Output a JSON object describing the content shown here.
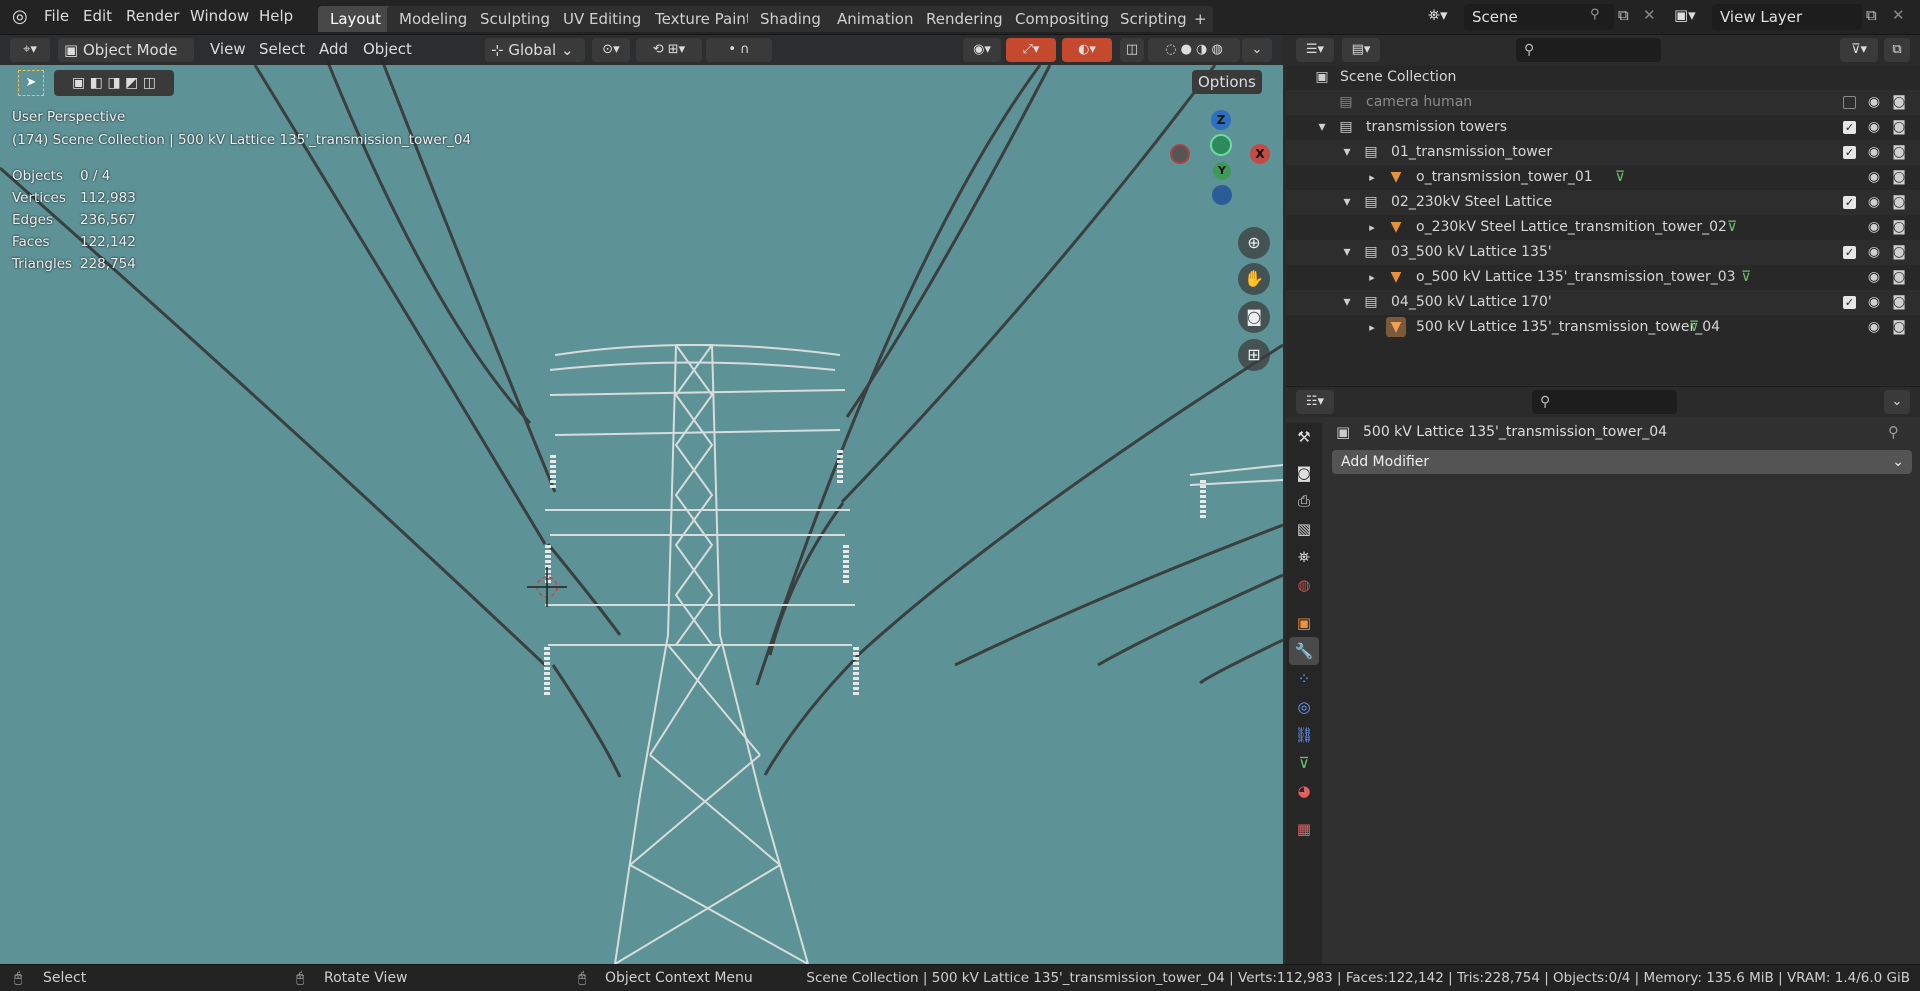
{
  "topbar": {
    "menus": [
      "File",
      "Edit",
      "Render",
      "Window",
      "Help"
    ],
    "workspaces": [
      "Layout",
      "Modeling",
      "Sculpting",
      "UV Editing",
      "Texture Paint",
      "Shading",
      "Animation",
      "Rendering",
      "Compositing",
      "Scripting"
    ],
    "active_workspace": "Layout",
    "add_workspace": "+",
    "scene_name": "Scene",
    "view_layer_name": "View Layer"
  },
  "viewport": {
    "mode": "Object Mode",
    "menus": [
      "View",
      "Select",
      "Add",
      "Object"
    ],
    "orientation": "Global",
    "options_label": "Options",
    "perspective_label": "User Perspective",
    "context_label": "(174) Scene Collection | 500 kV Lattice 135'_transmission_tower_04",
    "stats": [
      {
        "label": "Objects",
        "value": "0 / 4"
      },
      {
        "label": "Vertices",
        "value": "112,983"
      },
      {
        "label": "Edges",
        "value": "236,567"
      },
      {
        "label": "Faces",
        "value": "122,142"
      },
      {
        "label": "Triangles",
        "value": "228,754"
      }
    ],
    "gizmo": {
      "z": "Z",
      "y": "Y",
      "x": "X"
    },
    "background_color": "#5d9296"
  },
  "outliner": {
    "root": "Scene Collection",
    "rows": [
      {
        "name": "camera human",
        "depth": 1,
        "type": "collection",
        "expand": "",
        "disabled": true,
        "checked": false,
        "has_checkbox": true
      },
      {
        "name": "transmission towers",
        "depth": 1,
        "type": "collection",
        "expand": "▾",
        "disabled": false,
        "checked": true,
        "has_checkbox": true
      },
      {
        "name": "01_transmission_tower",
        "depth": 2,
        "type": "collection",
        "expand": "▾",
        "disabled": false,
        "checked": true,
        "has_checkbox": true
      },
      {
        "name": "o_transmission_tower_01",
        "depth": 3,
        "type": "object",
        "expand": "▸",
        "disabled": false,
        "checked": false,
        "has_checkbox": false
      },
      {
        "name": "02_230kV Steel Lattice",
        "depth": 2,
        "type": "collection",
        "expand": "▾",
        "disabled": false,
        "checked": true,
        "has_checkbox": true
      },
      {
        "name": "o_230kV Steel Lattice_transmition_tower_02",
        "depth": 3,
        "type": "object",
        "expand": "▸",
        "disabled": false,
        "checked": false,
        "has_checkbox": false
      },
      {
        "name": "03_500 kV Lattice 135'",
        "depth": 2,
        "type": "collection",
        "expand": "▾",
        "disabled": false,
        "checked": true,
        "has_checkbox": true
      },
      {
        "name": "o_500 kV Lattice 135'_transmission_tower_03",
        "depth": 3,
        "type": "object",
        "expand": "▸",
        "disabled": false,
        "checked": false,
        "has_checkbox": false
      },
      {
        "name": "04_500 kV Lattice 170'",
        "depth": 2,
        "type": "collection",
        "expand": "▾",
        "disabled": false,
        "checked": true,
        "has_checkbox": true
      },
      {
        "name": "500 kV Lattice 135'_transmission_tower_04",
        "depth": 3,
        "type": "object",
        "expand": "▸",
        "disabled": false,
        "checked": false,
        "has_checkbox": false,
        "active": true
      }
    ]
  },
  "properties": {
    "object_name": "500 kV Lattice 135'_transmission_tower_04",
    "add_modifier_label": "Add Modifier",
    "tabs": [
      "tool",
      "render",
      "output",
      "view-layer",
      "scene",
      "world",
      "object",
      "modifiers",
      "particles",
      "physics",
      "constraints",
      "data",
      "material",
      "texture"
    ],
    "active_tab": "modifiers"
  },
  "statusbar": {
    "select_label": "Select",
    "rotate_label": "Rotate View",
    "context_menu_label": "Object Context Menu",
    "info": "Scene Collection | 500 kV Lattice 135'_transmission_tower_04 | Verts:112,983 | Faces:122,142 | Tris:228,754 | Objects:0/4 | Memory: 135.6 MiB | VRAM: 1.4/6.0 GiB"
  }
}
